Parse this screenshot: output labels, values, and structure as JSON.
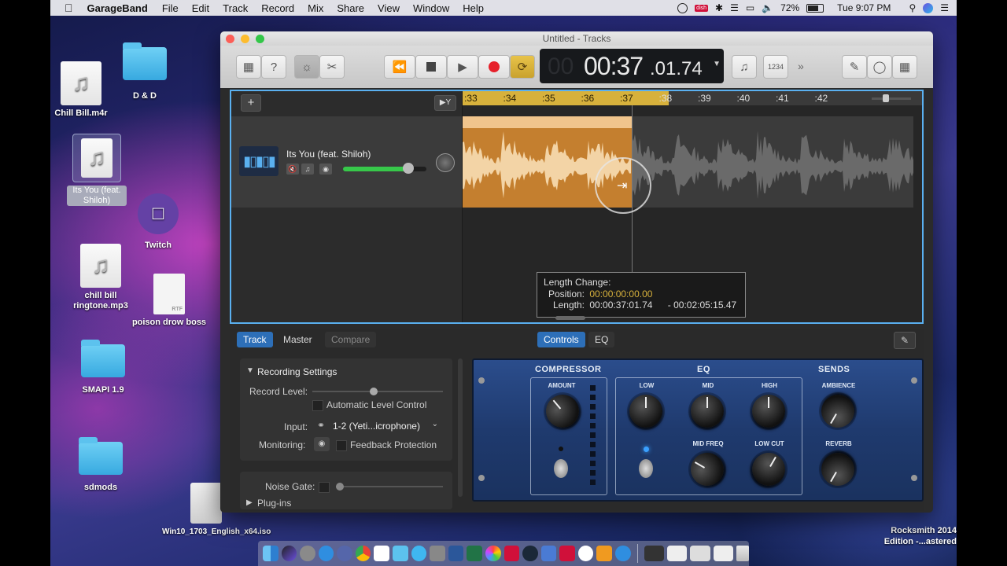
{
  "menubar": {
    "app": "GarageBand",
    "items": [
      "File",
      "Edit",
      "Track",
      "Record",
      "Mix",
      "Share",
      "View",
      "Window",
      "Help"
    ],
    "battery": "72%",
    "clock": "Tue 9:07 PM"
  },
  "desktop": {
    "icons": [
      {
        "label": "Chill Bill.m4r",
        "kind": "music-file"
      },
      {
        "label": "D & D",
        "kind": "folder"
      },
      {
        "label": "Its You (feat. Shiloh)",
        "kind": "music-file"
      },
      {
        "label": "Twitch",
        "kind": "app"
      },
      {
        "label": "chill bill ringtone.mp3",
        "kind": "music-file"
      },
      {
        "label": "poison drow boss",
        "kind": "rtf-file",
        "badge": "RTF"
      },
      {
        "label": "SMAPI 1.9",
        "kind": "folder"
      },
      {
        "label": "sdmods",
        "kind": "folder"
      },
      {
        "label": "Win10_1703_English_x64.iso",
        "kind": "disk-image"
      }
    ],
    "rocksmith": "Rocksmith 2014 Edition -...astered"
  },
  "window": {
    "title": "Untitled - Tracks",
    "lcd": {
      "time_main": "00:37",
      "time_frac": ".01.74",
      "bars_beats": "1234"
    },
    "ruler": [
      ":33",
      ":34",
      ":35",
      ":36",
      ":37",
      ":38",
      ":39",
      ":40",
      ":41",
      ":42"
    ],
    "track": {
      "name": "Its You (feat. Shiloh)",
      "volume": 0.78
    },
    "tooltip": {
      "title": "Length Change:",
      "position_label": "Position:",
      "position_value": "00:00:00:00.00",
      "length_label": "Length:",
      "length_value": "00:00:37:01.74",
      "remaining_value": "- 00:02:05:15.47"
    }
  },
  "smart_controls": {
    "tabs_left": [
      "Track",
      "Master",
      "Compare"
    ],
    "tabs_center": [
      "Controls",
      "EQ"
    ],
    "recording_settings": "Recording Settings",
    "record_level": "Record Level:",
    "auto_level": "Automatic Level Control",
    "input_label": "Input:",
    "input_value": "1-2  (Yeti...icrophone)",
    "monitoring_label": "Monitoring:",
    "feedback": "Feedback Protection",
    "noise_gate": "Noise Gate:",
    "plugins": "Plug-ins",
    "plugin": {
      "sections": [
        "COMPRESSOR",
        "EQ",
        "SENDS"
      ],
      "knobs": [
        "AMOUNT",
        "LOW",
        "MID",
        "HIGH",
        "AMBIENCE",
        "MID FREQ",
        "LOW CUT",
        "REVERB"
      ]
    }
  },
  "colors": {
    "accent": "#2d6fb8",
    "region": "#c47f2f",
    "loop": "#d7b13c",
    "selection": "#5ab0f0"
  }
}
